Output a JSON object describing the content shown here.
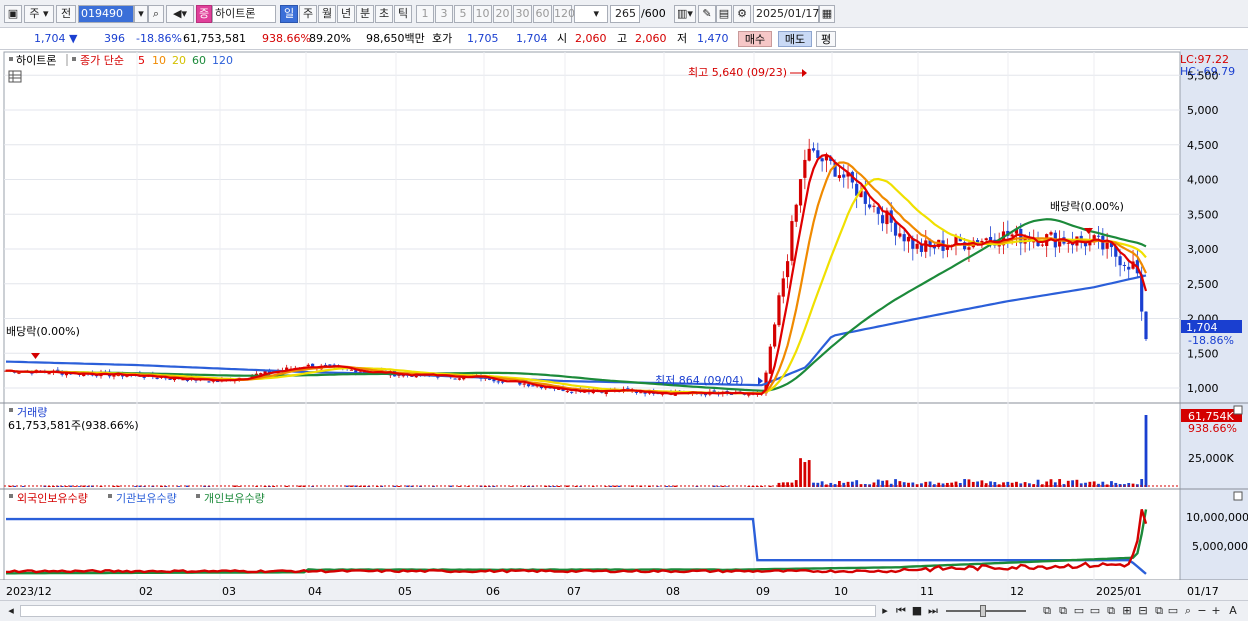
{
  "toolbar": {
    "market_select": "주",
    "type_select": "전",
    "code": "019490",
    "stock_badge": "증",
    "stock_name": "하이트론",
    "period_day": "일",
    "period_week": "주",
    "period_month": "월",
    "period_year": "년",
    "period_minute": "분",
    "period_second": "초",
    "period_tick": "틱",
    "intervals": [
      "1",
      "3",
      "5",
      "10",
      "20",
      "30",
      "60",
      "120"
    ],
    "count": "265",
    "count_max": "/600",
    "date": "2025/01/17"
  },
  "quote": {
    "price": "1,704",
    "arrow": "▼",
    "change": "396",
    "change_pct": "-18.86%",
    "volume": "61,753,581",
    "volume_ratio": "938.66%",
    "ratio2": "89.20%",
    "amount": "98,650백만",
    "ask_label": "호가",
    "ask": "1,705",
    "bid": "1,704",
    "open_label": "시",
    "open": "2,060",
    "high_label": "고",
    "high": "2,060",
    "low_label": "저",
    "low": "1,470",
    "buy_label": "매수",
    "sell_label": "매도",
    "avg_label": "평"
  },
  "price_panel": {
    "legend_name": "하이트론",
    "legend_type": "종가 단순",
    "ma_labels": [
      "5",
      "10",
      "20",
      "60",
      "120"
    ],
    "ma_colors": [
      "#e00000",
      "#f08a00",
      "#f0e000",
      "#1c8a3a",
      "#2b5fd9"
    ],
    "lc_label": "LC:97.22",
    "hc_label": "HC:-69.79",
    "high_annotation": "최고 5,640 (09/23)",
    "low_annotation": "최저 864 (09/04)",
    "dividend_right": "배당락(0.00%)",
    "dividend_left": "배당락(0.00%)",
    "current_price_tag": "1,704",
    "current_pct": "-18.86%",
    "y_ticks": [
      "5,500",
      "5,000",
      "4,500",
      "4,000",
      "3,500",
      "3,000",
      "2,500",
      "2,000",
      "1,500",
      "1,000"
    ]
  },
  "volume_panel": {
    "title": "거래량",
    "value": "61,753,581주(938.66%)",
    "tag": "61,754K",
    "tag_pct": "938.66%",
    "y_tick": "25,000K"
  },
  "holdings_panel": {
    "legend": [
      "외국인보유수량",
      "기관보유수량",
      "개인보유수량"
    ],
    "legend_colors": [
      "#d40000",
      "#2b5fd9",
      "#1c8a3a"
    ],
    "y_ticks": [
      "10,000,000",
      "5,000,000"
    ]
  },
  "x_axis": {
    "labels": [
      "2023/12",
      "02",
      "03",
      "04",
      "05",
      "06",
      "07",
      "08",
      "09",
      "10",
      "11",
      "12",
      "2025/01",
      "01/17"
    ]
  },
  "chart_data": {
    "type": "line",
    "x": [
      "2023/12",
      "02",
      "03",
      "04",
      "05",
      "06",
      "07",
      "08",
      "09/04",
      "09/23",
      "10",
      "11",
      "12",
      "2025/01",
      "01/17"
    ],
    "series": [
      {
        "name": "5",
        "values": [
          1250,
          1180,
          1100,
          1320,
          1200,
          1150,
          980,
          940,
          900,
          4400,
          4200,
          3000,
          3200,
          3100,
          2650
        ]
      },
      {
        "name": "120",
        "values": [
          1380,
          1330,
          1280,
          1230,
          1200,
          1150,
          1100,
          1070,
          1040,
          1300,
          1750,
          2000,
          2250,
          2450,
          2620
        ]
      }
    ],
    "ylim": [
      700,
      5800
    ]
  }
}
